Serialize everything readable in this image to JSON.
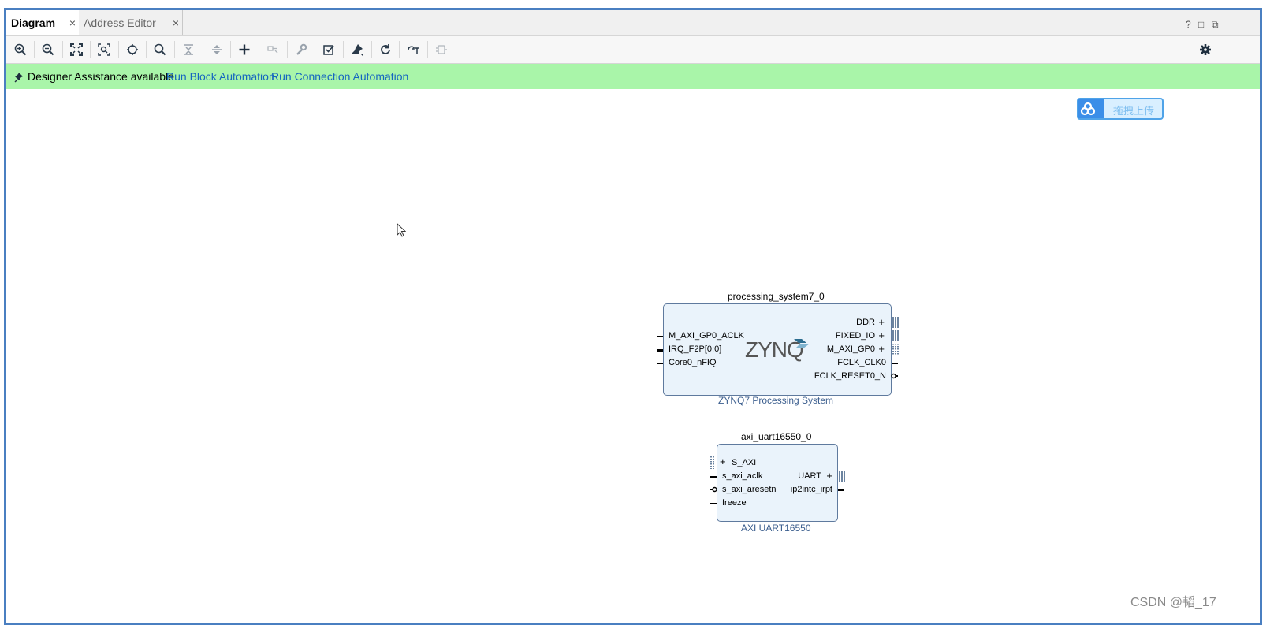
{
  "tabs": [
    {
      "label": "Diagram",
      "active": true
    },
    {
      "label": "Address Editor",
      "active": false
    }
  ],
  "tab_close_glyph": "×",
  "window_controls": {
    "help": "?",
    "maximize": "□",
    "restore": "⧉"
  },
  "toolbar": {
    "icons": [
      "zoom-in-icon",
      "zoom-out-icon",
      "fit-view-icon",
      "zoom-fit-selection-icon",
      "auto-connect-icon",
      "search-icon",
      "collapse-all-icon",
      "expand-all-icon",
      "add-ip-icon",
      "make-connection-icon",
      "properties-icon",
      "validate-design-icon",
      "pin-icon",
      "regenerate-layout-icon",
      "optimize-routing-icon",
      "add-module-icon"
    ],
    "settings_icon": "gear-icon"
  },
  "banner": {
    "message": "Designer Assistance available.",
    "link_block": "Run Block Automation",
    "link_connection": "Run Connection Automation",
    "bg_color": "#a9f5a9",
    "link_color": "#1565c0"
  },
  "upload_button": {
    "label": "拖拽上传"
  },
  "blocks": {
    "ps7": {
      "instance": "processing_system7_0",
      "ip_name": "ZYNQ7 Processing System",
      "logo": "ZYNQ",
      "left_ports": [
        "M_AXI_GP0_ACLK",
        "IRQ_F2P[0:0]",
        "Core0_nFIQ"
      ],
      "right_ports": [
        "DDR",
        "FIXED_IO",
        "M_AXI_GP0",
        "FCLK_CLK0",
        "FCLK_RESET0_N"
      ]
    },
    "uart": {
      "instance": "axi_uart16550_0",
      "ip_name": "AXI UART16550",
      "left_ports": [
        "S_AXI",
        "s_axi_aclk",
        "s_axi_aresetn",
        "freeze"
      ],
      "right_ports": [
        "UART",
        "ip2intc_irpt"
      ]
    }
  },
  "watermark": "CSDN @韬_17"
}
